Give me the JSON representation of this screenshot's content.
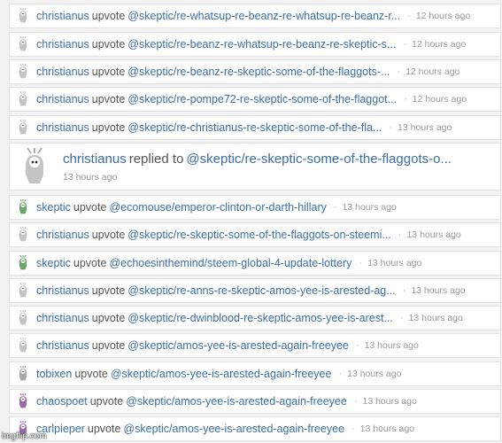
{
  "activity": [
    {
      "user": "christianus",
      "verb": "upvote",
      "link": "@skeptic/re-whatsup-re-beanz-re-whatsup-re-beanz-r...",
      "time": "12 hours ago",
      "avatar_color": "#b0b0b0"
    },
    {
      "user": "christianus",
      "verb": "upvote",
      "link": "@skeptic/re-beanz-re-whatsup-re-beanz-re-skeptic-s...",
      "time": "12 hours ago",
      "avatar_color": "#b0b0b0"
    },
    {
      "user": "christianus",
      "verb": "upvote",
      "link": "@skeptic/re-beanz-re-skeptic-some-of-the-flaggots-...",
      "time": "12 hours ago",
      "avatar_color": "#b0b0b0"
    },
    {
      "user": "christianus",
      "verb": "upvote",
      "link": "@skeptic/re-pompe72-re-skeptic-some-of-the-flaggot...",
      "time": "12 hours ago",
      "avatar_color": "#b0b0b0"
    },
    {
      "user": "christianus",
      "verb": "upvote",
      "link": "@skeptic/re-christianus-re-skeptic-some-of-the-fla...",
      "time": "13 hours ago",
      "avatar_color": "#b0b0b0"
    },
    {
      "user": "christianus",
      "verb": "replied to",
      "link": "@skeptic/re-skeptic-some-of-the-flaggots-o...",
      "time": "13 hours ago",
      "avatar_color": "#b0b0b0",
      "big": true
    },
    {
      "user": "skeptic",
      "verb": "upvote",
      "link": "@ecomouse/emperor-clinton-or-darth-hillary",
      "time": "13 hours ago",
      "avatar_color": "#3a8a3a"
    },
    {
      "user": "christianus",
      "verb": "upvote",
      "link": "@skeptic/re-skeptic-some-of-the-flaggots-on-steemi...",
      "time": "13 hours ago",
      "avatar_color": "#b0b0b0"
    },
    {
      "user": "skeptic",
      "verb": "upvote",
      "link": "@echoesinthemind/steem-global-4-update-lottery",
      "time": "13 hours ago",
      "avatar_color": "#3a8a3a"
    },
    {
      "user": "christianus",
      "verb": "upvote",
      "link": "@skeptic/re-anns-re-skeptic-amos-yee-is-arested-ag...",
      "time": "13 hours ago",
      "avatar_color": "#b0b0b0"
    },
    {
      "user": "christianus",
      "verb": "upvote",
      "link": "@skeptic/re-dwinblood-re-skeptic-amos-yee-is-arest...",
      "time": "13 hours ago",
      "avatar_color": "#b0b0b0"
    },
    {
      "user": "christianus",
      "verb": "upvote",
      "link": "@skeptic/amos-yee-is-arested-again-freeyee",
      "time": "13 hours ago",
      "avatar_color": "#b0b0b0"
    },
    {
      "user": "tobixen",
      "verb": "upvote",
      "link": "@skeptic/amos-yee-is-arested-again-freeyee",
      "time": "13 hours ago",
      "avatar_color": "#8a8a8a"
    },
    {
      "user": "chaospoet",
      "verb": "upvote",
      "link": "@skeptic/amos-yee-is-arested-again-freeyee",
      "time": "13 hours ago",
      "avatar_color": "#7a3a8a"
    },
    {
      "user": "carlpieper",
      "verb": "upvote",
      "link": "@skeptic/amos-yee-is-arested-again-freeyee",
      "time": "13 hours ago",
      "avatar_color": "#7a3a8a"
    }
  ],
  "separator": "·",
  "watermark": "imgflip.com"
}
